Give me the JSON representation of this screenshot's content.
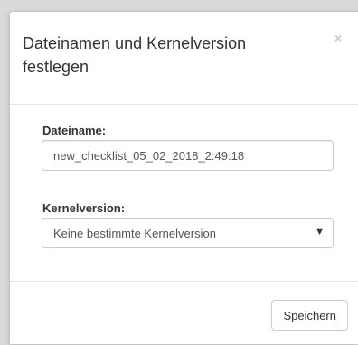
{
  "dialog": {
    "title": "Dateinamen und Kernelversion festlegen",
    "close_symbol": "×"
  },
  "form": {
    "filename_label": "Dateiname:",
    "filename_value": "new_checklist_05_02_2018_2:49:18",
    "kernel_label": "Kernelversion:",
    "kernel_selected": "Keine bestimmte Kernelversion"
  },
  "footer": {
    "save_label": "Speichern"
  },
  "icons": {
    "close": "close-icon",
    "dropdown": "caret-down-icon"
  }
}
